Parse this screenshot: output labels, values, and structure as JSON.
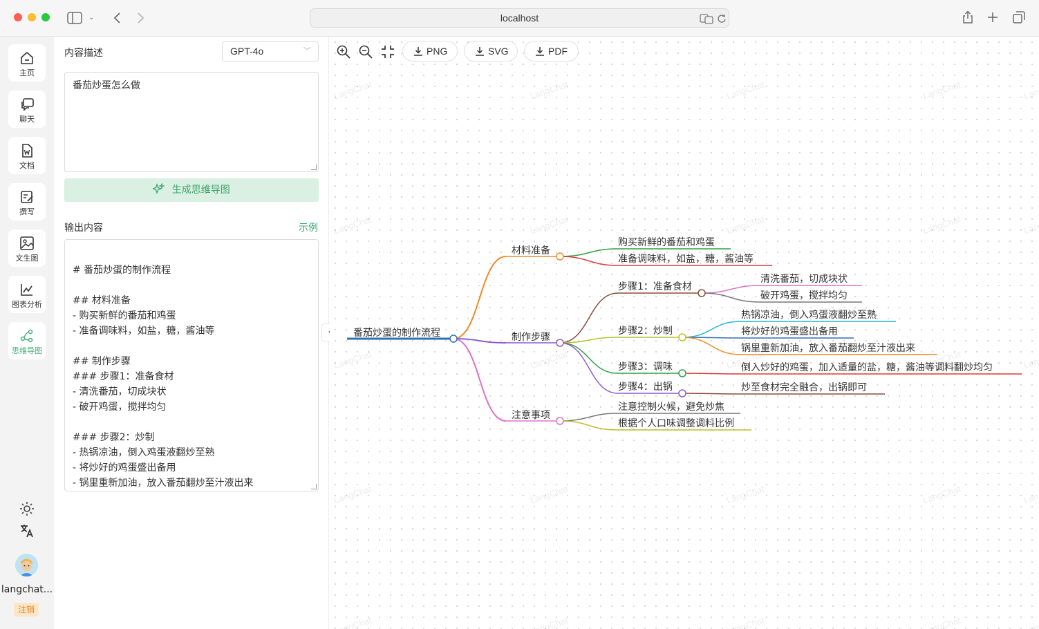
{
  "browser": {
    "url": "localhost"
  },
  "sidebar": {
    "items": [
      {
        "label": "主页",
        "icon": "home-icon"
      },
      {
        "label": "聊天",
        "icon": "chat-icon"
      },
      {
        "label": "文档",
        "icon": "document-icon"
      },
      {
        "label": "撰写",
        "icon": "write-icon"
      },
      {
        "label": "文生图",
        "icon": "image-icon"
      },
      {
        "label": "图表分析",
        "icon": "chart-icon"
      },
      {
        "label": "思维导图",
        "icon": "mindmap-icon",
        "active": true
      }
    ],
    "user_name": "langchat...",
    "logout_label": "注销"
  },
  "panel": {
    "description_label": "内容描述",
    "model_selected": "GPT-4o",
    "description_value": "番茄炒蛋怎么做",
    "generate_button": "生成思维导图",
    "output_label": "输出内容",
    "example_link": "示例",
    "output_lines": [
      "",
      "# 番茄炒蛋的制作流程",
      "",
      "## 材料准备",
      "- 购买新鲜的番茄和鸡蛋",
      "- 准备调味料，如盐，糖，酱油等",
      "",
      "## 制作步骤",
      "### 步骤1：准备食材",
      "- 清洗番茄，切成块状",
      "- 破开鸡蛋，搅拌均匀",
      "",
      "### 步骤2：炒制",
      "- 热锅凉油，倒入鸡蛋液翻炒至熟",
      "- 将炒好的鸡蛋盛出备用",
      "- 锅里重新加油，放入番茄翻炒至汁液出来"
    ]
  },
  "toolbar": {
    "png": "PNG",
    "svg": "SVG",
    "pdf": "PDF"
  },
  "watermark_text": "LangChat",
  "mindmap": {
    "root": "番茄炒蛋的制作流程",
    "branches": [
      {
        "label": "材料准备",
        "color": "#f08a24",
        "children": [
          {
            "label": "购买新鲜的番茄和鸡蛋",
            "color": "#2ea043"
          },
          {
            "label": "准备调味料，如盐，糖，酱油等",
            "color": "#e03a3a"
          }
        ]
      },
      {
        "label": "制作步骤",
        "color": "#8e5bd0",
        "children": [
          {
            "label": "步骤1：准备食材",
            "color": "#8b4a3a",
            "children": [
              {
                "label": "清洗番茄，切成块状",
                "color": "#e070c8"
              },
              {
                "label": "破开鸡蛋，搅拌均匀",
                "color": "#777777"
              }
            ]
          },
          {
            "label": "步骤2：炒制",
            "color": "#b8c02a",
            "children": [
              {
                "label": "热锅凉油，倒入鸡蛋液翻炒至熟",
                "color": "#22b4d4"
              },
              {
                "label": "将炒好的鸡蛋盛出备用",
                "color": "#2f6fb8"
              },
              {
                "label": "锅里重新加油，放入番茄翻炒至汁液出来",
                "color": "#f08a24"
              }
            ]
          },
          {
            "label": "步骤3：调味",
            "color": "#2ea043",
            "children": [
              {
                "label": "倒入炒好的鸡蛋，加入适量的盐，糖，酱油等调料翻炒均匀",
                "color": "#e03a3a"
              }
            ]
          },
          {
            "label": "步骤4：出锅",
            "color": "#8e5bd0",
            "children": [
              {
                "label": "炒至食材完全融合，出锅即可",
                "color": "#8b4a3a"
              }
            ]
          }
        ]
      },
      {
        "label": "注意事项",
        "color": "#e070c8",
        "children": [
          {
            "label": "注意控制火候，避免炒焦",
            "color": "#777777"
          },
          {
            "label": "根据个人口味调整调料比例",
            "color": "#b8c02a"
          }
        ]
      }
    ],
    "root_color": "#2f6fb8"
  }
}
